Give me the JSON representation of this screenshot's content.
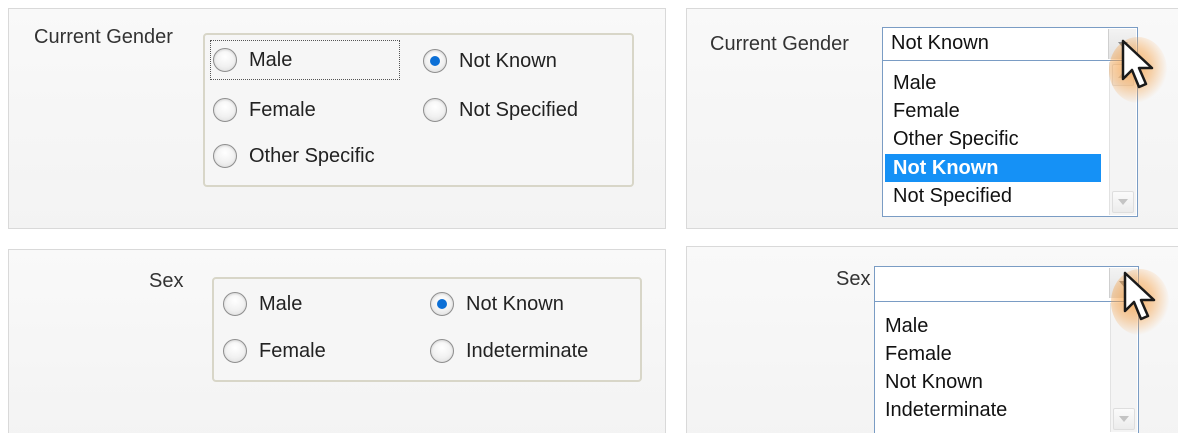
{
  "gender_radio": {
    "label": "Current Gender",
    "options": [
      {
        "label": "Male",
        "checked": false
      },
      {
        "label": "Female",
        "checked": false
      },
      {
        "label": "Other Specific",
        "checked": false
      },
      {
        "label": "Not Known",
        "checked": true
      },
      {
        "label": "Not Specified",
        "checked": false
      }
    ]
  },
  "gender_select": {
    "label": "Current Gender",
    "selected_value": "Not Known",
    "options": [
      "Male",
      "Female",
      "Other Specific",
      "Not Known",
      "Not Specified"
    ],
    "highlighted_option": "Not Known"
  },
  "sex_radio": {
    "label": "Sex",
    "options": [
      {
        "label": "Male",
        "checked": false
      },
      {
        "label": "Female",
        "checked": false
      },
      {
        "label": "Not Known",
        "checked": true
      },
      {
        "label": "Indeterminate",
        "checked": false
      }
    ]
  },
  "sex_select": {
    "label": "Sex",
    "selected_value": "",
    "options": [
      "Male",
      "Female",
      "Not Known",
      "Indeterminate"
    ]
  },
  "colors": {
    "accent": "#0b6fd6",
    "highlight": "#1591f6",
    "cursor_glow": "#f59632"
  },
  "icons": {
    "cursor": "mouse-pointer-icon",
    "dropdown": "chevron-down-icon"
  }
}
